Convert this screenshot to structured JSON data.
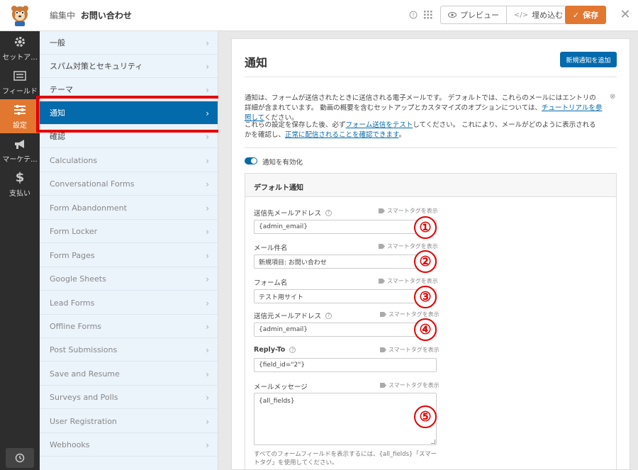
{
  "topbar": {
    "editing_prefix": "編集中",
    "form_name": "お問い合わせ",
    "preview_label": "プレビュー",
    "embed_label": "埋め込む",
    "save_label": "保存"
  },
  "dark_nav": [
    {
      "label": "セットア...",
      "icon": "gear-icon"
    },
    {
      "label": "フィールド",
      "icon": "fields-icon"
    },
    {
      "label": "設定",
      "icon": "sliders-icon",
      "active": true
    },
    {
      "label": "マーケテ...",
      "icon": "megaphone-icon"
    },
    {
      "label": "支払い",
      "icon": "dollar-icon"
    }
  ],
  "settings_list": [
    {
      "label": "一般"
    },
    {
      "label": "スパム対策とセキュリティ"
    },
    {
      "label": "テーマ"
    },
    {
      "label": "通知",
      "active": true
    },
    {
      "label": "確認"
    },
    {
      "label": "Calculations"
    },
    {
      "label": "Conversational Forms"
    },
    {
      "label": "Form Abandonment"
    },
    {
      "label": "Form Locker"
    },
    {
      "label": "Form Pages"
    },
    {
      "label": "Google Sheets"
    },
    {
      "label": "Lead Forms"
    },
    {
      "label": "Offline Forms"
    },
    {
      "label": "Post Submissions"
    },
    {
      "label": "Save and Resume"
    },
    {
      "label": "Surveys and Polls"
    },
    {
      "label": "User Registration"
    },
    {
      "label": "Webhooks"
    }
  ],
  "panel": {
    "title": "通知",
    "add_button": "新規通知を追加",
    "desc1_part1": "通知は、フォームが送信されたときに送信される電子メールです。 デフォルトでは、これらのメールにはエントリの詳細が含まれています。 動画の概要を含むセットアップとカスタマイズのオプションについては、",
    "desc1_link": "チュートリアルを参照して",
    "desc1_part2": "ください。",
    "desc2_part1": "これらの設定を保存した後、必ず",
    "desc2_link1": "フォーム送信をテスト",
    "desc2_part2": "してください。 これにより、メールがどのように表示されるかを確認し、",
    "desc2_link2": "正常に配信されることを確認できます",
    "desc2_part3": "。",
    "toggle_label": "通知を有効化",
    "toggle_on": true,
    "box_title": "デフォルト通知",
    "smart_tag": "スマートタグを表示",
    "fields": [
      {
        "label": "送信先メールアドレス",
        "value": "{admin_email}",
        "help": true
      },
      {
        "label": "メール件名",
        "value": "新規項目: お問い合わせ",
        "help": false
      },
      {
        "label": "フォーム名",
        "value": "テスト用サイト",
        "help": false
      },
      {
        "label": "送信元メールアドレス",
        "value": "{admin_email}",
        "help": true
      },
      {
        "label": "Reply-To",
        "value": "{field_id=\"2\"}",
        "help": true
      }
    ],
    "message": {
      "label": "メールメッセージ",
      "value": "{all_fields}"
    },
    "hint": "すべてのフォームフィールドを表示するには、{all_fields}「スマートタグ」を使用してください。"
  },
  "annotations": [
    "①",
    "②",
    "③",
    "④",
    "⑤"
  ],
  "colors": {
    "accent_orange": "#e27730",
    "primary_blue": "#036aab",
    "highlight_red": "#e30000"
  }
}
